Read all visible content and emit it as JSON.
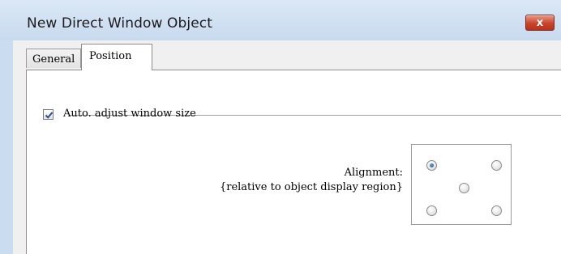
{
  "window": {
    "title": "New Direct Window Object",
    "close_glyph": "x"
  },
  "tabs": [
    {
      "label": "General",
      "selected": false
    },
    {
      "label": "Position",
      "selected": true
    }
  ],
  "position": {
    "auto_adjust_label": "Auto. adjust window size",
    "auto_adjust_checked": true,
    "alignment_label": "Alignment:",
    "alignment_sublabel": "{relative to object display region}",
    "alignment_options": [
      "top-left",
      "top-right",
      "center",
      "bottom-left",
      "bottom-right"
    ],
    "alignment_selected": "top-left"
  },
  "colors": {
    "titlebar": "#c8daef",
    "close_button": "#c8452c",
    "radio_selected": "#1d4f8a"
  }
}
